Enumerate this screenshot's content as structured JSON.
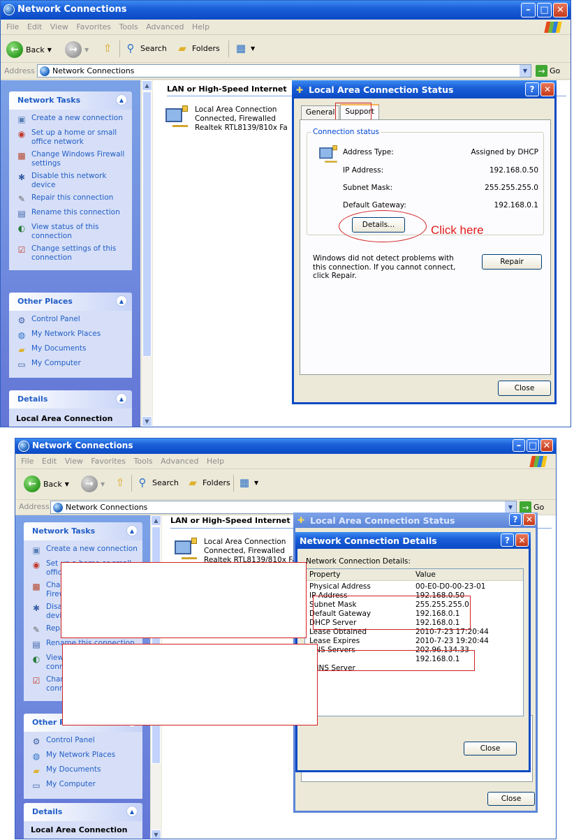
{
  "window": {
    "title": "Network Connections",
    "menu": [
      "File",
      "Edit",
      "View",
      "Favorites",
      "Tools",
      "Advanced",
      "Help"
    ],
    "toolbar": {
      "back": "Back",
      "search": "Search",
      "folders": "Folders"
    },
    "address": {
      "label": "Address",
      "value": "Network Connections",
      "go": "Go"
    }
  },
  "sidebar": {
    "network_tasks": {
      "title": "Network Tasks",
      "items": [
        {
          "label": "Create a new connection",
          "icon": "new-connection-icon"
        },
        {
          "label": "Set up a home or small office network",
          "icon": "home-network-icon"
        },
        {
          "label": "Change Windows Firewall settings",
          "icon": "firewall-icon"
        },
        {
          "label": "Disable this network device",
          "icon": "disable-icon"
        },
        {
          "label": "Repair this connection",
          "icon": "repair-icon"
        },
        {
          "label": "Rename this connection",
          "icon": "rename-icon"
        },
        {
          "label": "View status of this connection",
          "icon": "status-icon"
        },
        {
          "label": "Change settings of this connection",
          "icon": "settings-icon"
        }
      ]
    },
    "other_places": {
      "title": "Other Places",
      "items": [
        {
          "label": "Control Panel",
          "icon": "control-panel-icon"
        },
        {
          "label": "My Network Places",
          "icon": "network-places-icon"
        },
        {
          "label": "My Documents",
          "icon": "documents-icon"
        },
        {
          "label": "My Computer",
          "icon": "computer-icon"
        }
      ]
    },
    "details": {
      "title": "Details",
      "item": "Local Area Connection"
    }
  },
  "pane": {
    "group_header": "LAN or High-Speed Internet",
    "connection": {
      "name": "Local Area Connection",
      "status": "Connected, Firewalled",
      "adapter": "Realtek RTL8139/810x Fa"
    }
  },
  "status_dialog": {
    "title": "Local Area Connection Status",
    "tabs": [
      "General",
      "Support"
    ],
    "group_label": "Connection status",
    "fields": [
      {
        "label": "Address Type:",
        "value": "Assigned by DHCP"
      },
      {
        "label": "IP Address:",
        "value": "192.168.0.50"
      },
      {
        "label": "Subnet Mask:",
        "value": "255.255.255.0"
      },
      {
        "label": "Default Gateway:",
        "value": "192.168.0.1"
      }
    ],
    "details_button": "Details...",
    "annotation": "Click here",
    "message": "Windows did not detect problems with this connection. If you cannot connect, click Repair.",
    "repair_button": "Repair",
    "close_button": "Close"
  },
  "details_dialog": {
    "title": "Network Connection Details",
    "caption": "Network Connection Details:",
    "columns": [
      "Property",
      "Value"
    ],
    "rows": [
      {
        "property": "Physical Address",
        "value": "00-E0-D0-00-23-01"
      },
      {
        "property": "IP Address",
        "value": "192.168.0.50"
      },
      {
        "property": "Subnet Mask",
        "value": "255.255.255.0"
      },
      {
        "property": "Default Gateway",
        "value": "192.168.0.1"
      },
      {
        "property": "DHCP Server",
        "value": "192.168.0.1"
      },
      {
        "property": "Lease Obtained",
        "value": "2010-7-23 17:20:44"
      },
      {
        "property": "Lease Expires",
        "value": "2010-7-23 19:20:44"
      },
      {
        "property": "DNS Servers",
        "value": "202.96.134.33"
      },
      {
        "property": "",
        "value": "192.168.0.1"
      },
      {
        "property": "WINS Server",
        "value": ""
      }
    ],
    "close_button": "Close"
  }
}
